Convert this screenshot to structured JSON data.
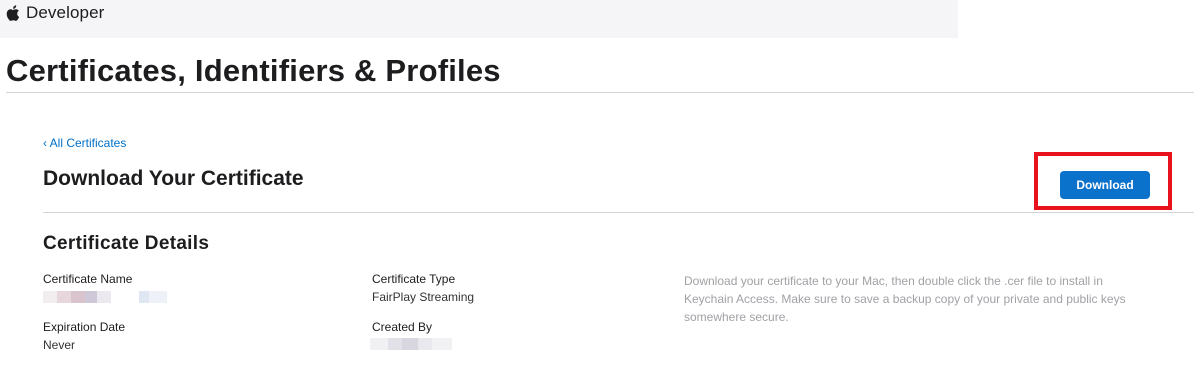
{
  "header": {
    "brand_label": "Developer"
  },
  "page": {
    "title": "Certificates, Identifiers & Profiles"
  },
  "nav": {
    "back_link": "‹ All Certificates"
  },
  "section": {
    "title": "Download Your Certificate",
    "download_button": "Download"
  },
  "details": {
    "title": "Certificate Details",
    "certificate_name_label": "Certificate Name",
    "certificate_type_label": "Certificate Type",
    "certificate_type_value": "FairPlay Streaming",
    "expiration_date_label": "Expiration Date",
    "expiration_date_value": "Never",
    "created_by_label": "Created By",
    "help_text": "Download your certificate to your Mac, then double click the .cer file to install in Keychain Access. Make sure to save a backup copy of your private and public keys somewhere secure."
  },
  "colors": {
    "accent": "#0b72cc",
    "link": "#0070c9",
    "highlight": "#e8121d",
    "muted_text": "#a1a1a6"
  },
  "icons": {
    "brand": "apple-icon"
  }
}
